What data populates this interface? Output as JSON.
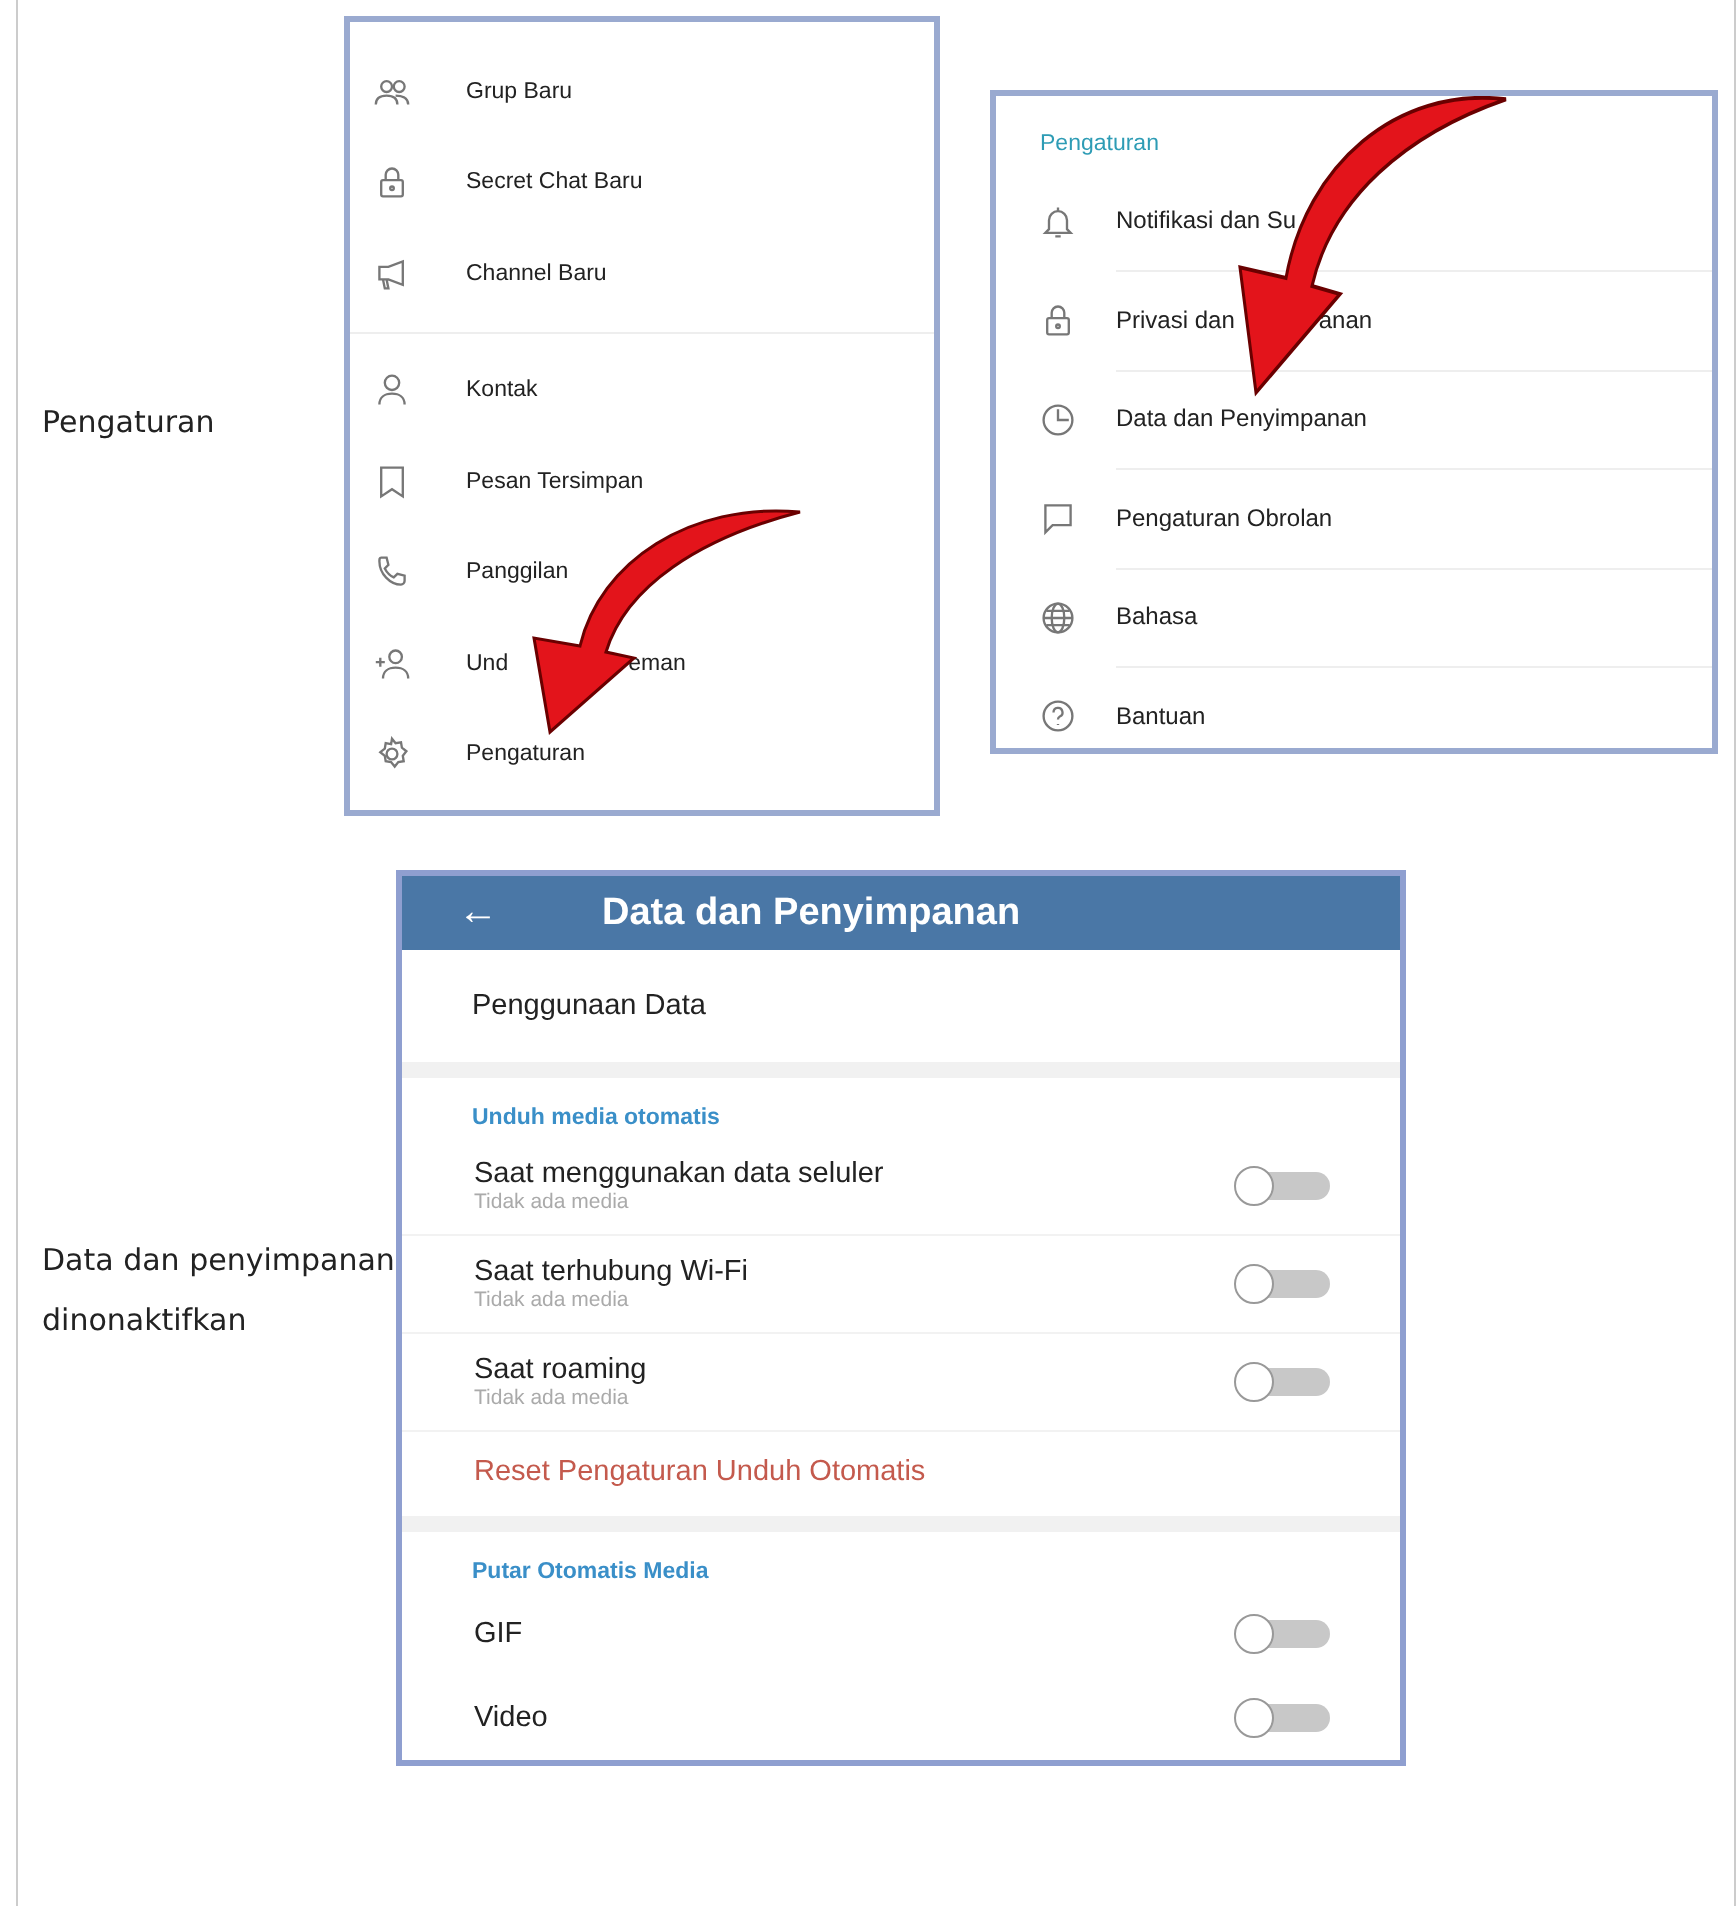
{
  "steps": [
    {
      "label": "Pengaturan"
    },
    {
      "label": "Data dan penyimpanan dinonaktifkan"
    }
  ],
  "menu": {
    "items": [
      {
        "kind": "group",
        "label": "Grup Baru"
      },
      {
        "kind": "lock",
        "label": "Secret Chat Baru"
      },
      {
        "kind": "megaphone",
        "label": "Channel Baru"
      },
      {
        "kind": "person",
        "label": "Kontak"
      },
      {
        "kind": "bookmark",
        "label": "Pesan Tersimpan"
      },
      {
        "kind": "phone",
        "label": "Panggilan"
      },
      {
        "kind": "addperson",
        "label": "Und",
        "tail": "eman"
      },
      {
        "kind": "gear",
        "label": "Pengaturan"
      }
    ]
  },
  "settings": {
    "title": "Pengaturan",
    "items": [
      {
        "kind": "bell",
        "label": "Notifikasi dan Su"
      },
      {
        "kind": "lock",
        "label": "Privasi dan",
        "tail": "anan"
      },
      {
        "kind": "clock",
        "label": "Data dan Penyimpanan"
      },
      {
        "kind": "chat",
        "label": "Pengaturan Obrolan"
      },
      {
        "kind": "globe",
        "label": "Bahasa"
      },
      {
        "kind": "help",
        "label": "Bantuan"
      }
    ]
  },
  "data_screen": {
    "title": "Data dan Penyimpanan",
    "back": "←",
    "usage": "Penggunaan Data",
    "auto_download": {
      "title": "Unduh media otomatis",
      "rows": [
        {
          "label": "Saat menggunakan data seluler",
          "sub": "Tidak ada media",
          "on": false
        },
        {
          "label": "Saat terhubung Wi-Fi",
          "sub": "Tidak ada media",
          "on": false
        },
        {
          "label": "Saat roaming",
          "sub": "Tidak ada media",
          "on": false
        }
      ],
      "reset": "Reset Pengaturan Unduh Otomatis"
    },
    "autoplay": {
      "title": "Putar Otomatis Media",
      "rows": [
        {
          "label": "GIF",
          "on": false
        },
        {
          "label": "Video",
          "on": false
        }
      ]
    }
  }
}
